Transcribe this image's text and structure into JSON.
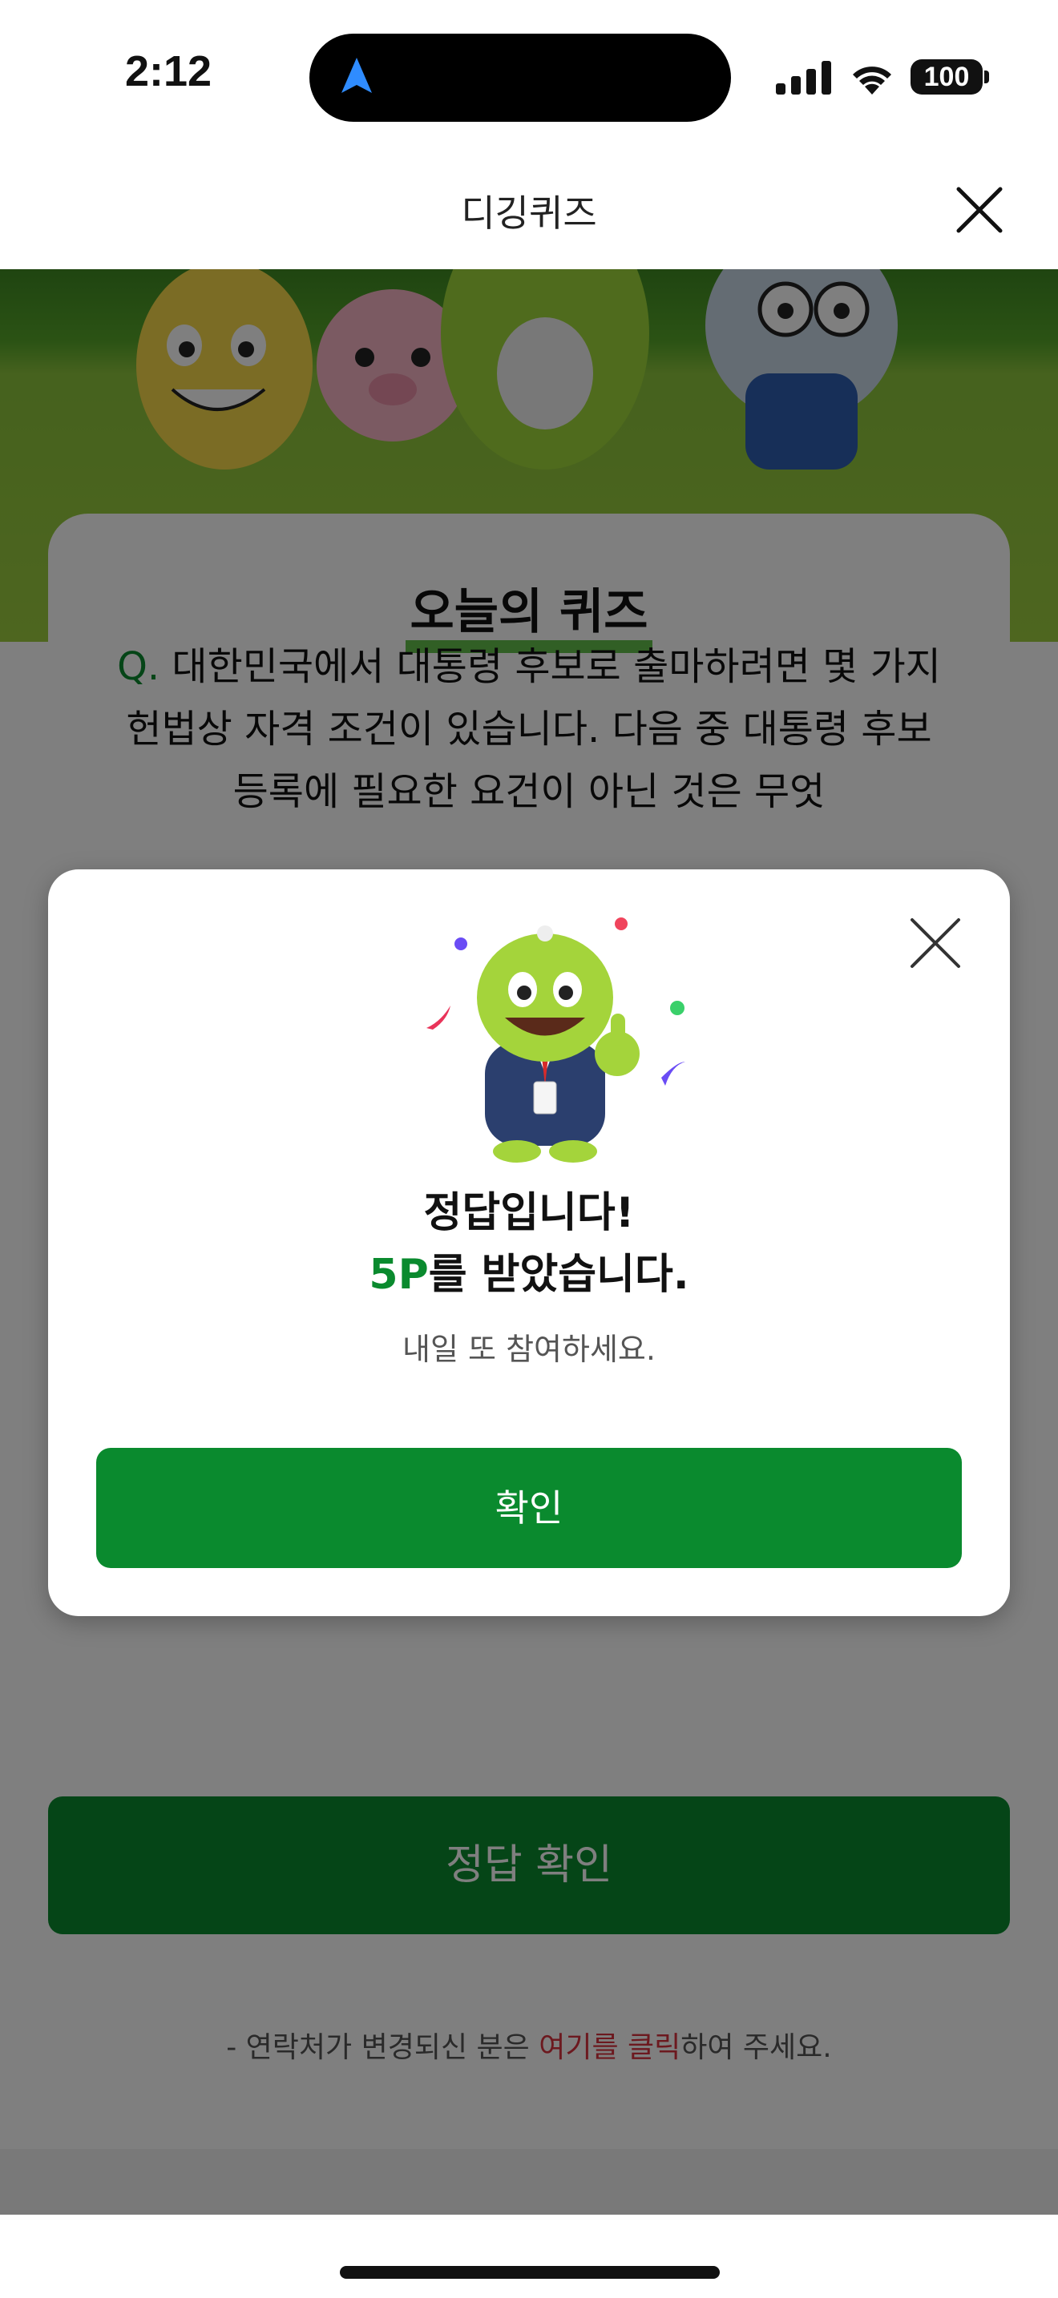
{
  "status_bar": {
    "time": "2:12",
    "battery": "100"
  },
  "nav": {
    "title": "디깅퀴즈",
    "close_icon": "close-icon"
  },
  "quiz": {
    "heading": "오늘의 퀴즈",
    "q_prefix": "Q.",
    "question": "대한민국에서 대통령 후보로 출마하려면 몇 가지 헌법상 자격 조건이 있습니다. 다음 중 대통령 후보 등록에 필요한 요건이 아닌 것은 무엇",
    "check_button": "정답 확인"
  },
  "contact": {
    "prefix": "- 연락처가 변경되신 분은 ",
    "link": "여기를 클릭",
    "suffix": "하여 주세요."
  },
  "modal": {
    "title": "정답입니다!",
    "points": "5P",
    "points_suffix": "를 받았습니다.",
    "description": "내일 또 참여하세요.",
    "confirm_button": "확인"
  },
  "colors": {
    "brand_green": "#0a8a2e",
    "link_red": "#d8323e"
  }
}
